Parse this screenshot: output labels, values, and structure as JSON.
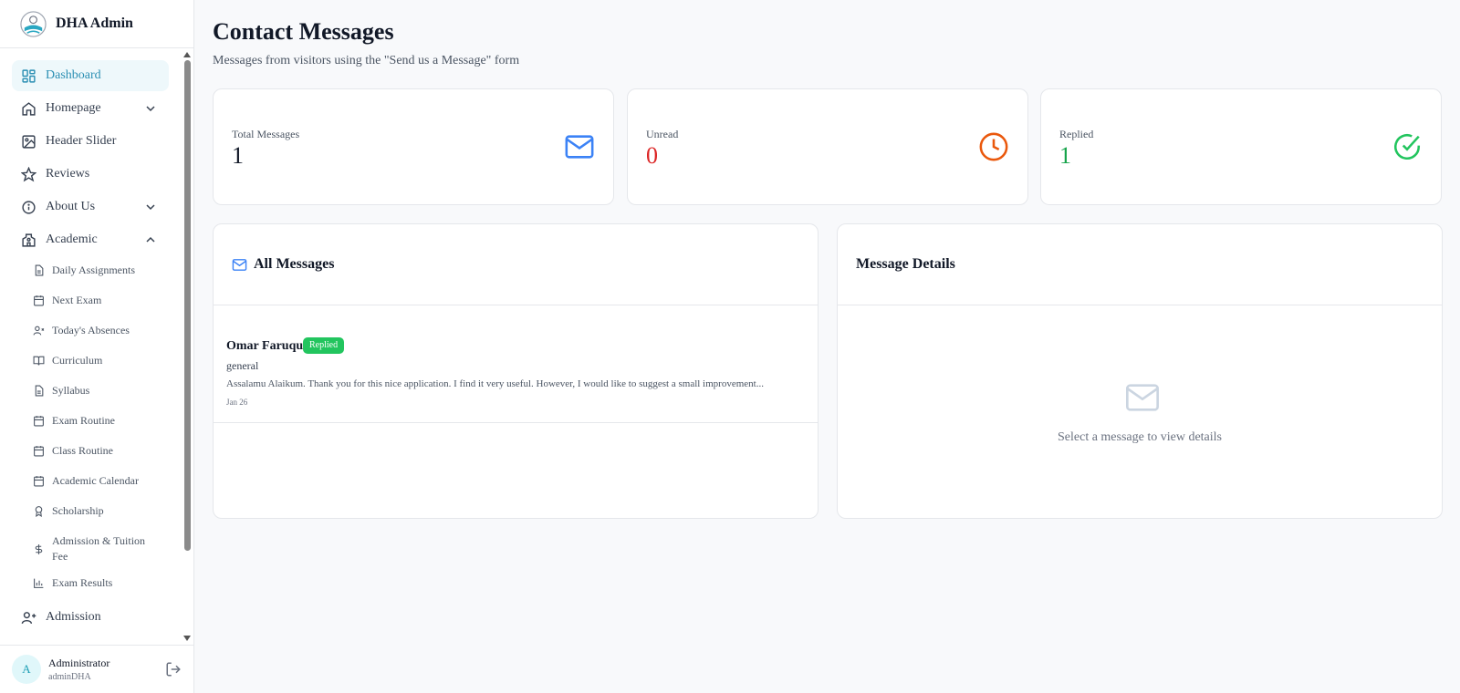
{
  "app": {
    "title": "DHA Admin"
  },
  "sidebar": {
    "items": [
      {
        "label": "Dashboard",
        "icon": "dashboard-icon",
        "active": true
      },
      {
        "label": "Homepage",
        "icon": "home-icon",
        "chevron": "down"
      },
      {
        "label": "Header Slider",
        "icon": "image-icon"
      },
      {
        "label": "Reviews",
        "icon": "star-icon"
      },
      {
        "label": "About Us",
        "icon": "info-icon",
        "chevron": "down"
      },
      {
        "label": "Academic",
        "icon": "school-icon",
        "chevron": "up"
      },
      {
        "label": "Admission",
        "icon": "user-plus-icon"
      }
    ],
    "academic_sub": [
      {
        "label": "Daily Assignments",
        "icon": "document-icon"
      },
      {
        "label": "Next Exam",
        "icon": "calendar-icon"
      },
      {
        "label": "Today's Absences",
        "icon": "user-x-icon"
      },
      {
        "label": "Curriculum",
        "icon": "book-icon"
      },
      {
        "label": "Syllabus",
        "icon": "document-icon"
      },
      {
        "label": "Exam Routine",
        "icon": "calendar-icon"
      },
      {
        "label": "Class Routine",
        "icon": "calendar-icon"
      },
      {
        "label": "Academic Calendar",
        "icon": "calendar-icon"
      },
      {
        "label": "Scholarship",
        "icon": "award-icon"
      },
      {
        "label": "Admission & Tuition Fee",
        "icon": "dollar-icon"
      },
      {
        "label": "Exam Results",
        "icon": "bar-chart-icon"
      }
    ]
  },
  "user": {
    "initial": "A",
    "name": "Administrator",
    "handle": "adminDHA"
  },
  "page": {
    "title": "Contact Messages",
    "subtitle": "Messages from visitors using the \"Send us a Message\" form"
  },
  "stats": [
    {
      "label": "Total Messages",
      "value": "1",
      "color": "#111827",
      "icon": "mail-icon",
      "icon_color": "#3b82f6"
    },
    {
      "label": "Unread",
      "value": "0",
      "color": "#dc2626",
      "icon": "clock-icon",
      "icon_color": "#ea580c"
    },
    {
      "label": "Replied",
      "value": "1",
      "color": "#16a34a",
      "icon": "check-circle-icon",
      "icon_color": "#22c55e"
    }
  ],
  "messages_panel": {
    "title": "All Messages",
    "items": [
      {
        "name": "Omar Faruque",
        "status": "Replied",
        "subject": "general",
        "preview": "Assalamu Alaikum. Thank you for this nice application. I find it very useful. However, I would like to suggest a small improvement...",
        "date": "Jan 26"
      }
    ]
  },
  "details_panel": {
    "title": "Message Details",
    "empty_text": "Select a message to view details"
  },
  "colors": {
    "accent": "#2b8fb3",
    "badge": "#22c55e"
  }
}
